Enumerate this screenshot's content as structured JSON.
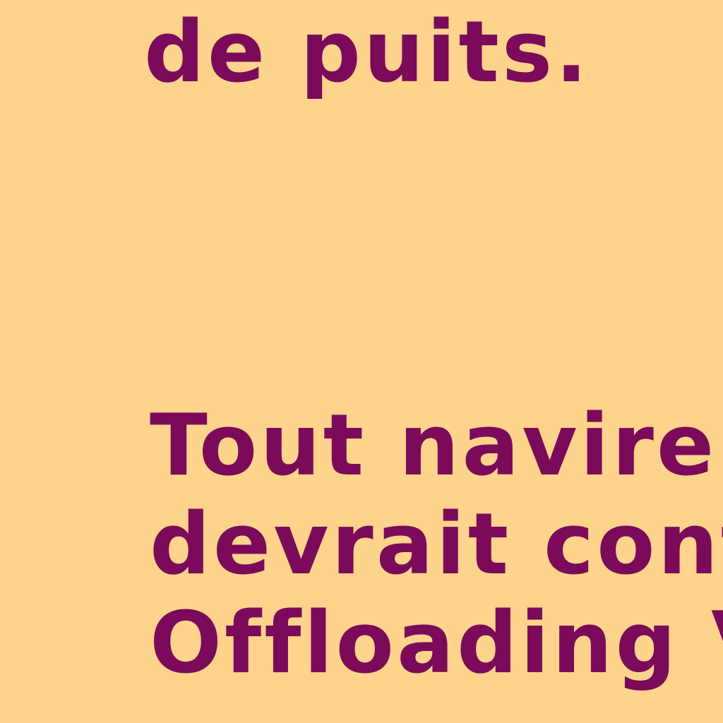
{
  "document": {
    "paragraph_1": {
      "lines": [
        "de puits."
      ]
    },
    "paragraph_2": {
      "lines": [
        "Tout navire pré",
        "devrait conta",
        "Offloading Vess",
        ""
      ]
    },
    "colors": {
      "background": "#FED48C",
      "text": "#7B0A5A"
    }
  }
}
